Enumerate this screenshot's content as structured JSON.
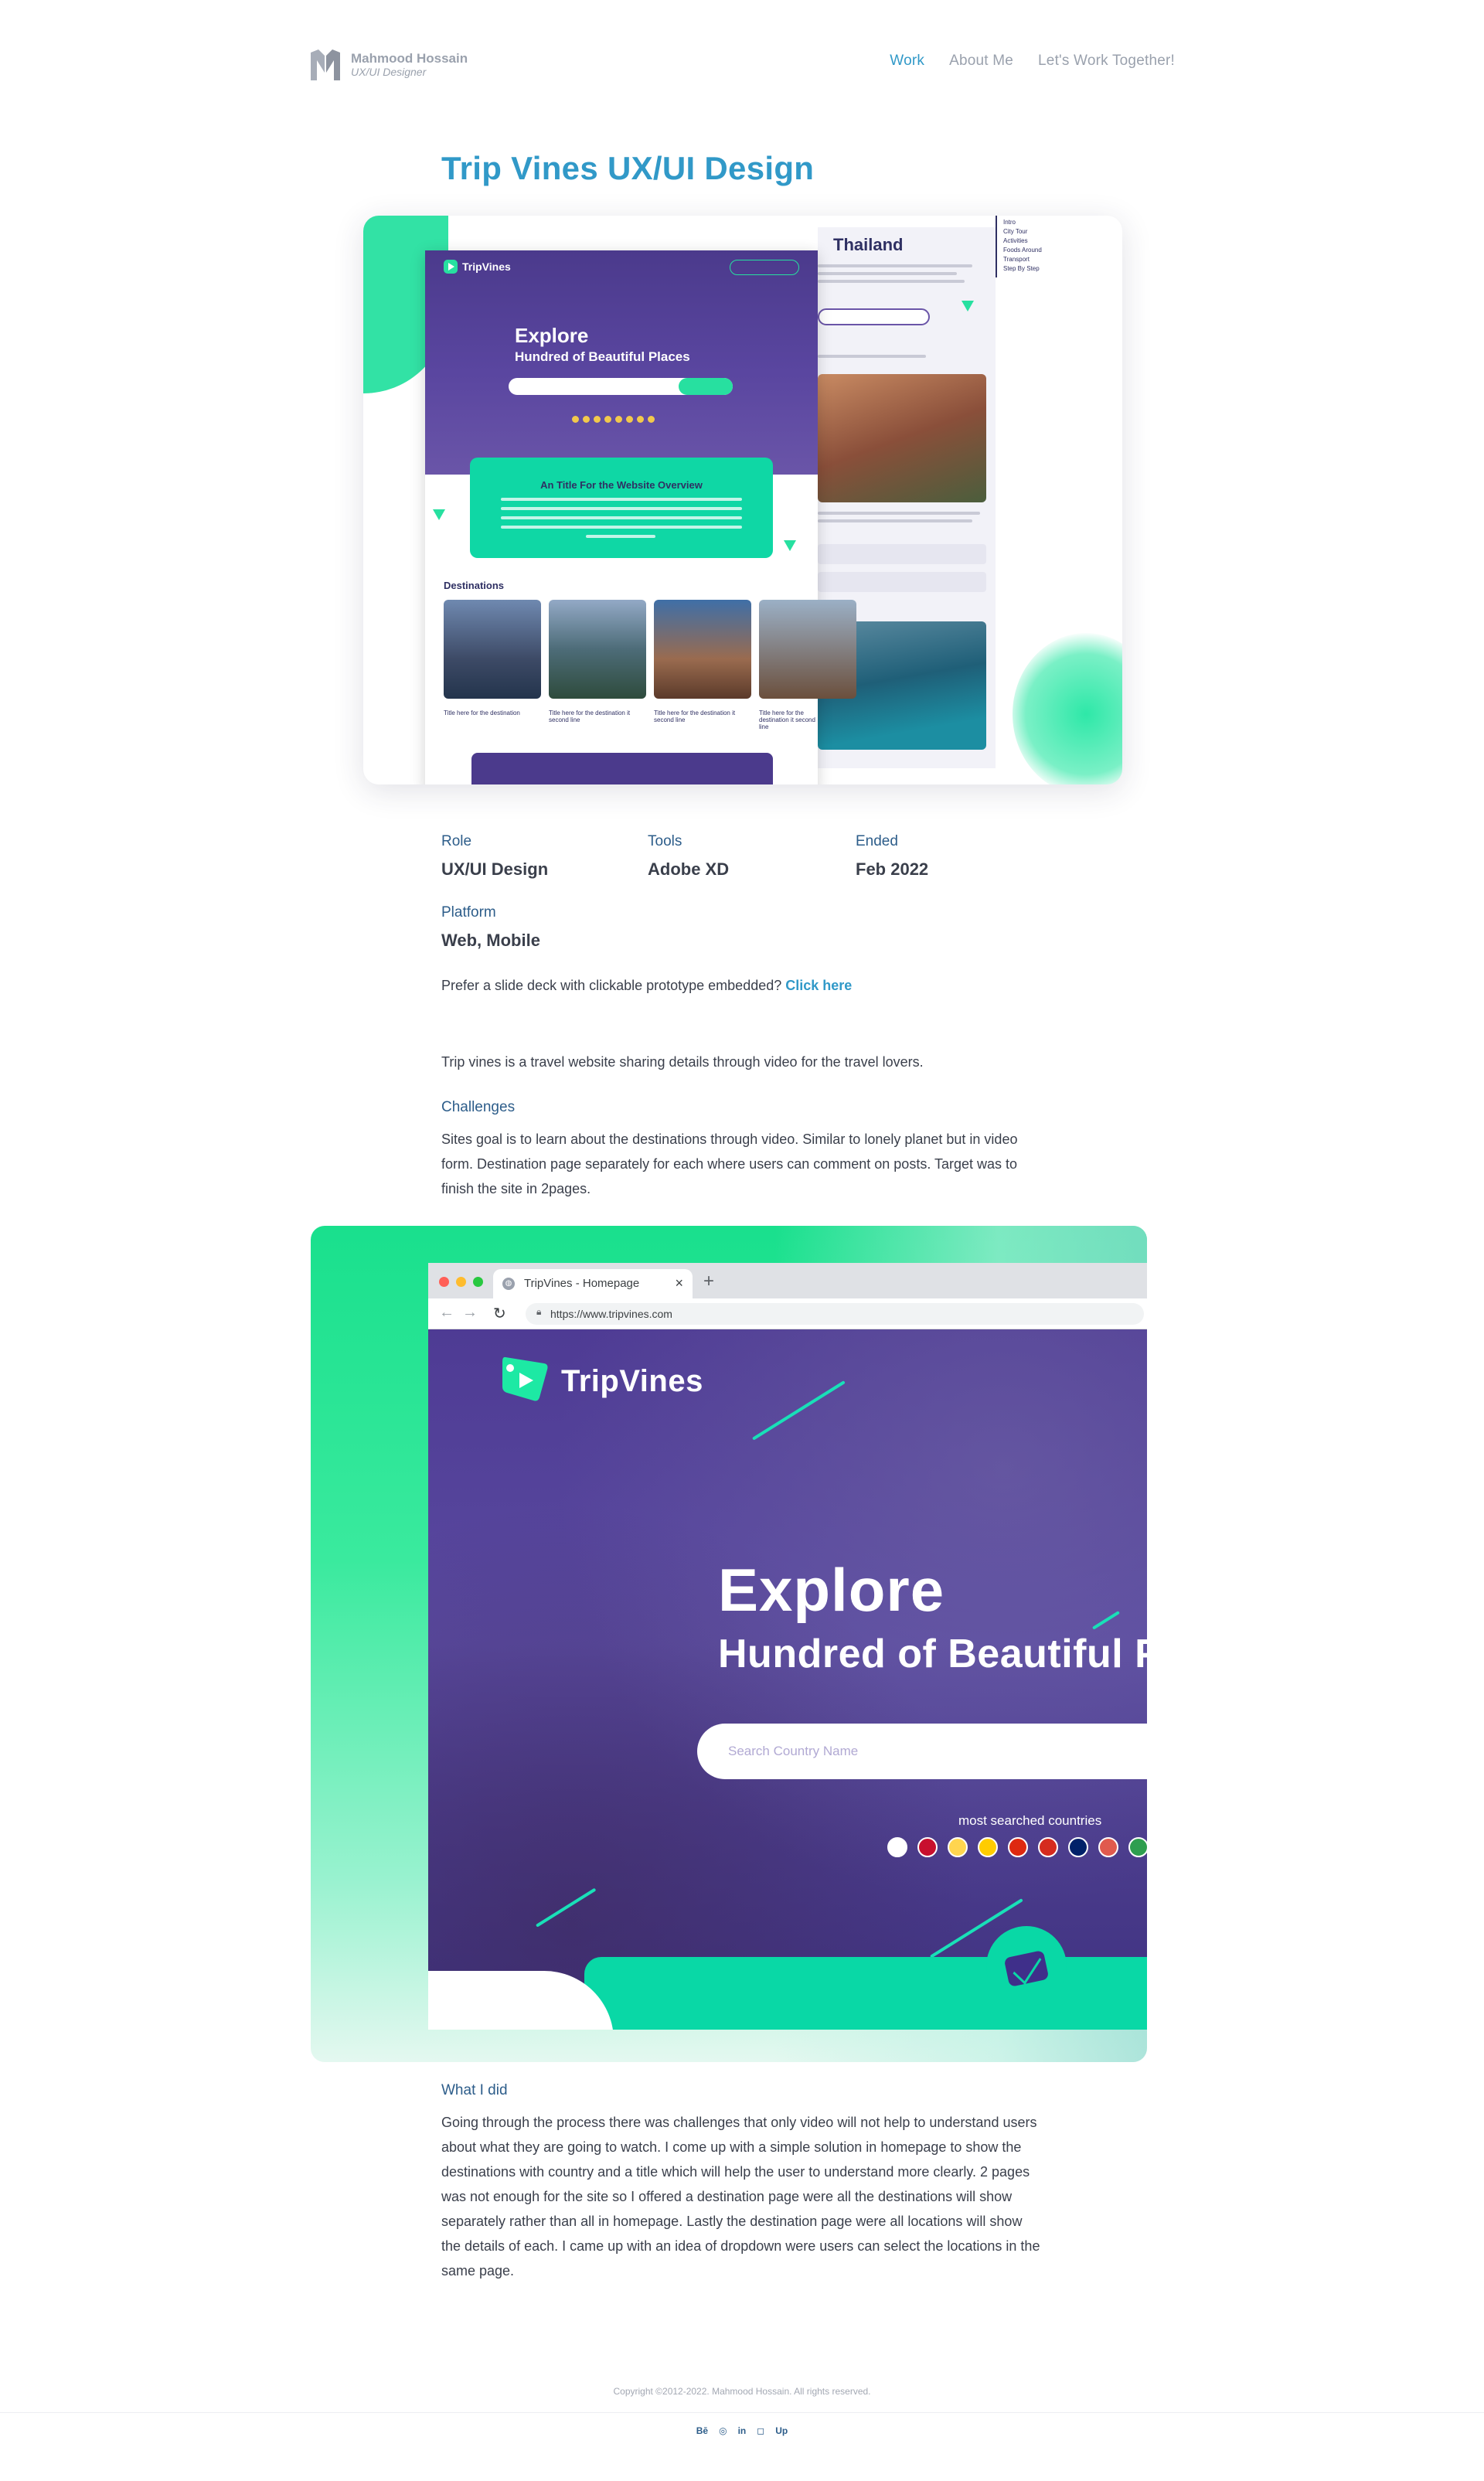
{
  "header": {
    "logo_name": "Mahmood Hossain",
    "logo_role": "UX/UI Designer",
    "nav": [
      {
        "label": "Work",
        "active": true
      },
      {
        "label": "About Me",
        "active": false
      },
      {
        "label": "Let's Work Together!",
        "active": false
      }
    ]
  },
  "page_title": "Trip Vines UX/UI Design",
  "hero": {
    "home_logo": "TripVines",
    "home_explore": "Explore",
    "home_sub": "Hundred of Beautiful Places",
    "overview_title": "An Title For the Website Overview",
    "destinations": "Destinations",
    "captions": [
      "Title here for the destination",
      "Title here for the destination it second line",
      "Title here for the destination it second line",
      "Title here for the destination it second line"
    ],
    "thailand_title": "Thailand",
    "side_nav": [
      "Intro",
      "City Tour",
      "Activities",
      "Foods Around",
      "Transport",
      "Step By Step"
    ]
  },
  "meta": {
    "role_label": "Role",
    "role_value": "UX/UI Design",
    "tools_label": "Tools",
    "tools_value": "Adobe XD",
    "ended_label": "Ended",
    "ended_value": "Feb 2022",
    "platform_label": "Platform",
    "platform_value": "Web, Mobile"
  },
  "slide_deck": {
    "text": "Prefer a slide deck with clickable prototype embedded?",
    "link": "Click here"
  },
  "intro": "Trip vines is a travel website sharing details through video for the travel lovers.",
  "challenges": {
    "heading": "Challenges",
    "body": "Sites goal is to learn about the destinations through video. Similar to lonely planet but in video form. Destination page separately for each where users can comment on posts. Target was to finish the site in 2pages."
  },
  "browser": {
    "tab_title": "TripVines - Homepage",
    "url": "https://www.tripvines.com",
    "logo_text": "TripVines",
    "explore": "Explore",
    "hundred": "Hundred of Beautiful Places",
    "search_placeholder": "Search Country Name",
    "most_searched": "most searched countries",
    "flag_colors": [
      "#ffffff",
      "#c8102e",
      "#ffd54f",
      "#ffcc00",
      "#de2910",
      "#d52b1e",
      "#012169",
      "#e05a4e",
      "#2e9e4f"
    ]
  },
  "what_i_did": {
    "heading": "What I did",
    "body": "Going through the process there was challenges that only video will not help to understand users about what they are going to watch. I come up with a simple solution in homepage to show the destinations with country and a title which will help the user to understand more clearly. 2 pages was not enough for the site so I offered a destination page were all the destinations will show separately rather than all in homepage. Lastly the destination page were all locations will show the details of each. I came up with an idea of dropdown were users can select the locations in the same page."
  },
  "footer": {
    "copyright": "Copyright ©2012-2022. Mahmood Hossain. All rights reserved.",
    "socials": [
      "Bē",
      "◎",
      "in",
      "◻",
      "Up"
    ]
  },
  "colors": {
    "accent": "#3199c8",
    "label": "#2d5d8a",
    "brand_purple": "#4e3b94",
    "brand_green": "#19e08d"
  }
}
